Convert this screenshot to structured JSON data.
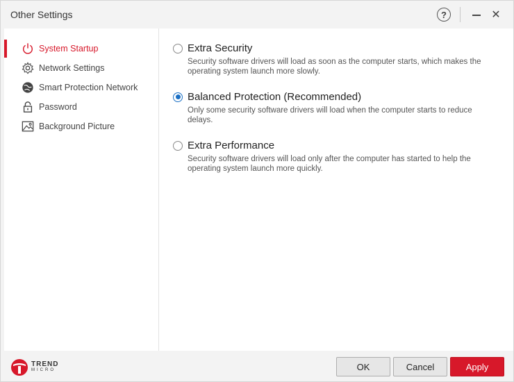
{
  "window": {
    "title": "Other Settings"
  },
  "titlebar": {
    "help": "?",
    "close": "✕"
  },
  "sidebar": {
    "items": [
      {
        "label": "System Startup",
        "icon": "power-icon",
        "active": true
      },
      {
        "label": "Network Settings",
        "icon": "gear-icon",
        "active": false
      },
      {
        "label": "Smart Protection Network",
        "icon": "globe-icon",
        "active": false
      },
      {
        "label": "Password",
        "icon": "lock-icon",
        "active": false
      },
      {
        "label": "Background Picture",
        "icon": "picture-icon",
        "active": false
      }
    ]
  },
  "options": [
    {
      "title": "Extra Security",
      "description": "Security software drivers will load as soon as the computer starts, which makes the operating system launch more slowly.",
      "checked": false
    },
    {
      "title": "Balanced Protection (Recommended)",
      "description": "Only some security software drivers will load when the computer starts to reduce delays.",
      "checked": true
    },
    {
      "title": "Extra Performance",
      "description": "Security software drivers will load only after the computer has started to help the operating system launch more quickly.",
      "checked": false
    }
  ],
  "brand": {
    "name": "TREND",
    "sub": "MICRO"
  },
  "footer": {
    "ok": "OK",
    "cancel": "Cancel",
    "apply": "Apply"
  },
  "colors": {
    "accent": "#d7182a",
    "radio": "#1a6fc4"
  }
}
